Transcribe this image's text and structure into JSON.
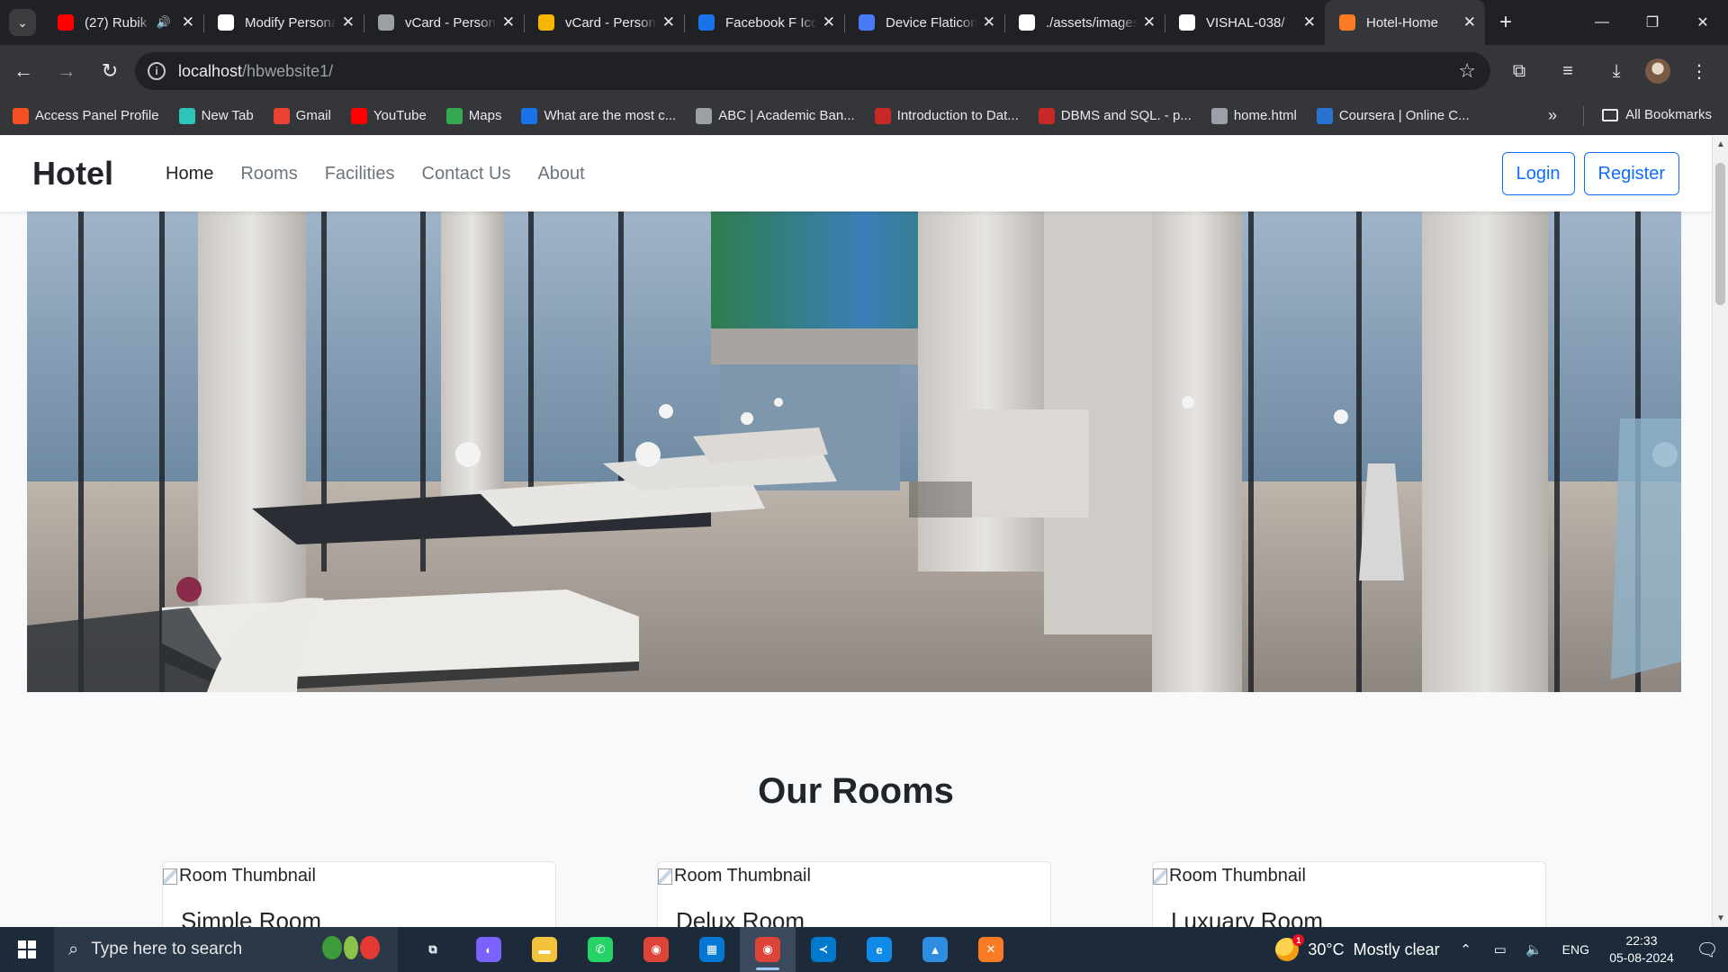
{
  "browser": {
    "tabs": [
      {
        "title": "(27) Rubik",
        "favicon_color": "#ff0000",
        "favicon": "youtube-icon",
        "has_audio": true
      },
      {
        "title": "Modify Persona",
        "favicon_color": "#ffffff",
        "favicon": "chatgpt-icon"
      },
      {
        "title": "vCard - Personal",
        "favicon_color": "#9aa0a6",
        "favicon": "globe-icon"
      },
      {
        "title": "vCard - Personal",
        "favicon_color": "#f6b500",
        "favicon": "vcard-icon"
      },
      {
        "title": "Facebook F Icon",
        "favicon_color": "#1a73e8",
        "favicon": "flag-icon"
      },
      {
        "title": "Device Flaticon",
        "favicon_color": "#4a7bf7",
        "favicon": "flaticon-icon"
      },
      {
        "title": "./assets/images",
        "favicon_color": "#ffffff",
        "favicon": "google-icon"
      },
      {
        "title": "VISHAL-038/",
        "favicon_color": "#ffffff",
        "favicon": "github-icon"
      },
      {
        "title": "Hotel-Home",
        "favicon_color": "#fb7a24",
        "favicon": "xampp-icon",
        "active": true
      }
    ],
    "url_host": "localhost",
    "url_path": "/hbwebsite1/",
    "bookmarks": [
      {
        "label": "Access Panel Profile",
        "color": "#f25022"
      },
      {
        "label": "New Tab",
        "color": "#2ec4b6"
      },
      {
        "label": "Gmail",
        "color": "#ea4335"
      },
      {
        "label": "YouTube",
        "color": "#ff0000"
      },
      {
        "label": "Maps",
        "color": "#34a853"
      },
      {
        "label": "What are the most c...",
        "color": "#1a73e8"
      },
      {
        "label": "ABC | Academic Ban...",
        "color": "#9aa0a6"
      },
      {
        "label": "Introduction to Dat...",
        "color": "#c62828"
      },
      {
        "label": "DBMS and SQL. - p...",
        "color": "#c62828"
      },
      {
        "label": "home.html",
        "color": "#9aa0a6"
      },
      {
        "label": "Coursera | Online C...",
        "color": "#2a73cc"
      }
    ],
    "all_bookmarks": "All Bookmarks"
  },
  "site": {
    "brand": "Hotel",
    "nav": [
      "Home",
      "Rooms",
      "Facilities",
      "Contact Us",
      "About"
    ],
    "login": "Login",
    "register": "Register",
    "section_title": "Our Rooms",
    "rooms": [
      {
        "alt": "Room Thumbnail",
        "name": "Simple Room"
      },
      {
        "alt": "Room Thumbnail",
        "name": "Delux Room"
      },
      {
        "alt": "Room Thumbnail",
        "name": "Luxuary Room"
      }
    ],
    "accent_color": "#0d6efd"
  },
  "taskbar": {
    "search_placeholder": "Type here to search",
    "weather_badge": "1",
    "temperature": "30°C",
    "weather": "Mostly clear",
    "language": "ENG",
    "time": "22:33",
    "date": "05-08-2024",
    "apps": [
      {
        "name": "task-view-icon",
        "color": "#1c2a3a",
        "glyph": "⧉"
      },
      {
        "name": "copilot-icon",
        "color": "#7b61ff",
        "glyph": "◐"
      },
      {
        "name": "file-explorer-icon",
        "color": "#f3c33b",
        "glyph": "▬"
      },
      {
        "name": "whatsapp-icon",
        "color": "#25d366",
        "glyph": "✆"
      },
      {
        "name": "chrome-icon",
        "color": "#db4437",
        "glyph": "◉"
      },
      {
        "name": "microsoft-store-icon",
        "color": "#0078d4",
        "glyph": "▦"
      },
      {
        "name": "chrome-profile-icon",
        "color": "#db4437",
        "glyph": "◉",
        "active": true
      },
      {
        "name": "vscode-icon",
        "color": "#007acc",
        "glyph": "≺"
      },
      {
        "name": "edge-icon",
        "color": "#0f8ae8",
        "glyph": "e"
      },
      {
        "name": "photos-icon",
        "color": "#2d8de0",
        "glyph": "▲"
      },
      {
        "name": "xampp-icon",
        "color": "#fb7a24",
        "glyph": "✕"
      }
    ]
  }
}
